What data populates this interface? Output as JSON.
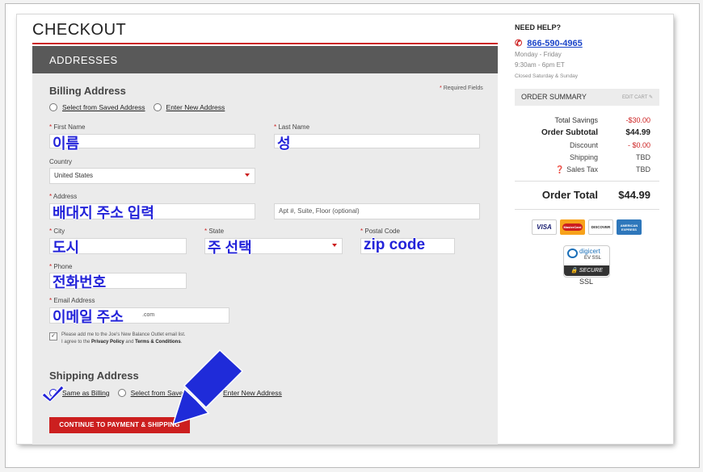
{
  "page": {
    "title": "CHECKOUT"
  },
  "section": {
    "title": "ADDRESSES"
  },
  "billing": {
    "heading": "Billing Address",
    "required_note": "Required Fields",
    "radio_saved": "Select from Saved Address",
    "radio_new": "Enter New Address",
    "first_name_label": "First Name",
    "first_name_value": "이름",
    "last_name_label": "Last Name",
    "last_name_value": "성",
    "country_label": "Country",
    "country_value": "United States",
    "address_label": "Address",
    "address_value": "배대지 주소 입력",
    "address2_placeholder": "Apt #, Suite, Floor (optional)",
    "city_label": "City",
    "city_value": "도시",
    "state_label": "State",
    "state_value": "주 선택",
    "postal_label": "Postal Code",
    "postal_value": "zip code",
    "phone_label": "Phone",
    "phone_value": "전화번호",
    "email_label": "Email Address",
    "email_value": "이메일 주소",
    "email_tail": ".com",
    "optin_line1": "Please add me to the Joe's New Balance Outlet email list.",
    "optin_line2_a": "I agree to the",
    "optin_privacy": "Privacy Policy",
    "optin_and": "and",
    "optin_terms": "Terms & Conditions"
  },
  "shipping": {
    "heading": "Shipping Address",
    "same_as_billing": "Same as Billing",
    "select_saved": "Select from Saved",
    "enter_new": "Enter New Address"
  },
  "continue_button": "CONTINUE TO PAYMENT & SHIPPING",
  "help": {
    "title": "NEED HELP?",
    "phone": "866-590-4965",
    "days": "Monday - Friday",
    "hours": "9:30am - 6pm ET",
    "closed": "Closed Saturday & Sunday"
  },
  "order_summary": {
    "title": "ORDER SUMMARY",
    "edit_cart": "EDIT CART",
    "rows": [
      {
        "label": "Total Savings",
        "value": "-$30.00"
      },
      {
        "label": "Order Subtotal",
        "value": "$44.99"
      },
      {
        "label": "Discount",
        "value": "- $0.00"
      },
      {
        "label": "Shipping",
        "value": "TBD"
      },
      {
        "label": "Sales Tax",
        "value": "TBD"
      }
    ],
    "total_label": "Order Total",
    "total_value": "$44.99"
  },
  "payment_cards": [
    "VISA",
    "MasterCard",
    "DISCOVER",
    "AMERICAN EXPRESS"
  ],
  "ssl_badge": {
    "brand": "digicert",
    "line2": "EV SSL",
    "secure": "SECURE",
    "ssl": "SSL"
  },
  "colors": {
    "accent_red": "#cc1f1f",
    "annotation_blue": "#2323d9",
    "link_blue": "#1a44c9"
  }
}
